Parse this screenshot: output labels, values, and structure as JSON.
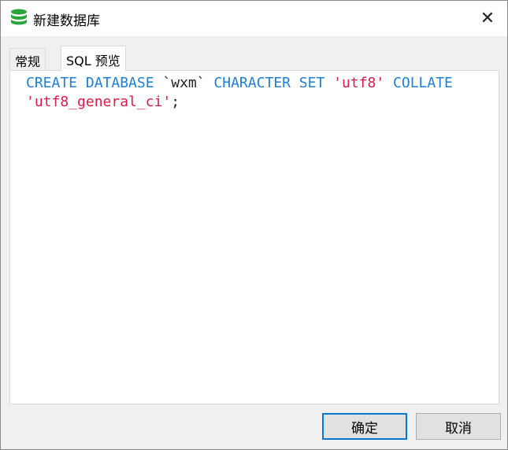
{
  "window": {
    "title": "新建数据库",
    "icon": "database-icon",
    "close_icon": "close-icon"
  },
  "tabs": [
    {
      "label": "常规",
      "active": false
    },
    {
      "label": "SQL 预览",
      "active": true
    }
  ],
  "sql": {
    "tokens": [
      {
        "text": "CREATE DATABASE ",
        "type": "keyword"
      },
      {
        "text": "`wxm` ",
        "type": "identifier"
      },
      {
        "text": "CHARACTER SET ",
        "type": "keyword"
      },
      {
        "text": "'utf8'",
        "type": "string"
      },
      {
        "text": " ",
        "type": "plain"
      },
      {
        "text": "COLLATE ",
        "type": "keyword"
      },
      {
        "text": "'utf8_general_ci'",
        "type": "string"
      },
      {
        "text": ";",
        "type": "plain"
      }
    ]
  },
  "buttons": {
    "ok": "确定",
    "cancel": "取消"
  },
  "colors": {
    "keyword": "#1e7fd6",
    "string": "#d81b49",
    "icon": "#2aa33a",
    "primary_border": "#0078d7"
  }
}
